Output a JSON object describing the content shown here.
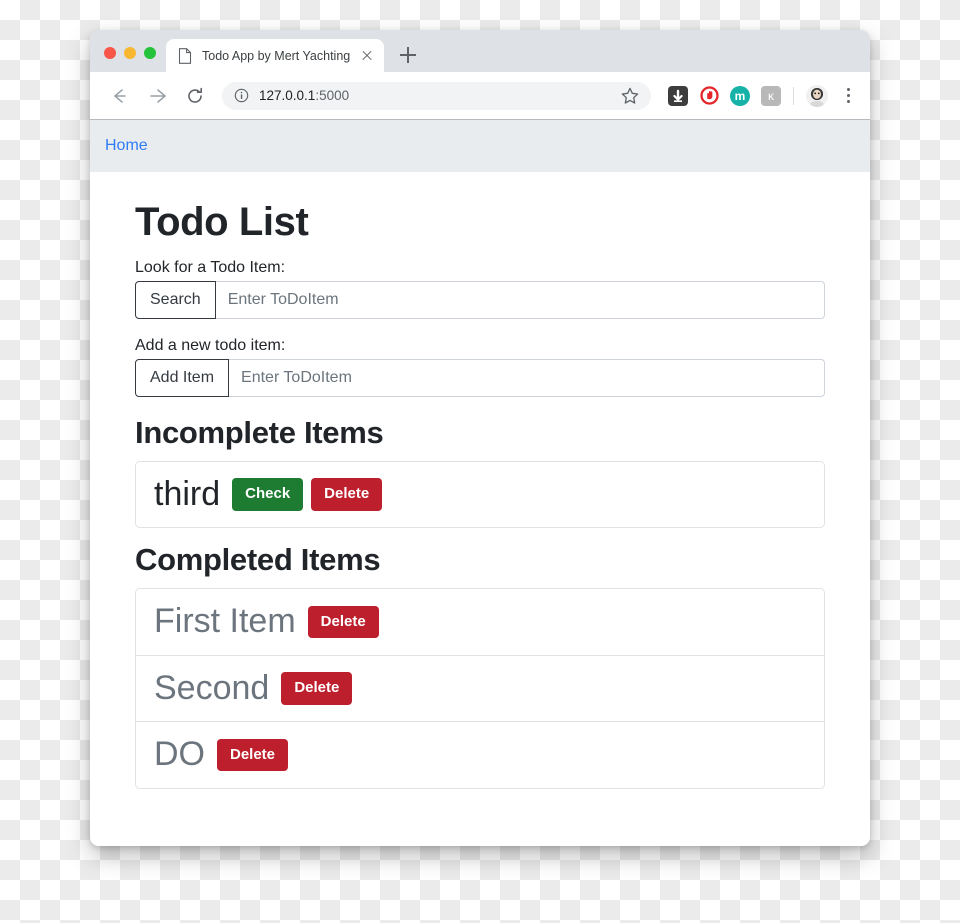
{
  "browser": {
    "traffic_lights": [
      "close",
      "minimize",
      "maximize"
    ],
    "tab": {
      "title": "Todo App by Mert Yachting",
      "favicon": "document-icon",
      "close_icon": "close-icon"
    },
    "new_tab_icon": "plus-icon",
    "toolbar": {
      "back_icon": "back-arrow-icon",
      "forward_icon": "forward-arrow-icon",
      "reload_icon": "reload-icon",
      "info_icon": "info-circle-icon",
      "url_host": "127.0.0.1",
      "url_port": ":5000",
      "star_icon": "bookmark-star-icon",
      "extensions": [
        {
          "name": "download-manager-icon",
          "glyph": "⬇"
        },
        {
          "name": "adblock-shield-icon",
          "glyph": ""
        },
        {
          "name": "momentum-extension-icon",
          "glyph": "m"
        },
        {
          "name": "readability-extension-icon",
          "glyph": "ĸ"
        }
      ],
      "avatar_name": "profile-avatar",
      "menu_icon": "three-dot-menu-icon"
    }
  },
  "page": {
    "navbar": {
      "home_link": "Home"
    },
    "title": "Todo List",
    "search": {
      "label": "Look for a Todo Item:",
      "button": "Search",
      "placeholder": "Enter ToDoItem",
      "value": ""
    },
    "add": {
      "label": "Add a new todo item:",
      "button": "Add Item",
      "placeholder": "Enter ToDoItem",
      "value": ""
    },
    "incomplete": {
      "heading": "Incomplete Items",
      "items": [
        {
          "text": "third",
          "check_label": "Check",
          "delete_label": "Delete"
        }
      ]
    },
    "completed": {
      "heading": "Completed Items",
      "items": [
        {
          "text": "First Item",
          "delete_label": "Delete"
        },
        {
          "text": "Second",
          "delete_label": "Delete"
        },
        {
          "text": "DO",
          "delete_label": "Delete"
        }
      ]
    }
  },
  "colors": {
    "link": "#2f7cf6",
    "navbar_bg": "#e9ecef",
    "check_green": "#1e7b32",
    "delete_red": "#bd1f2d",
    "muted_text": "#6c757d"
  }
}
